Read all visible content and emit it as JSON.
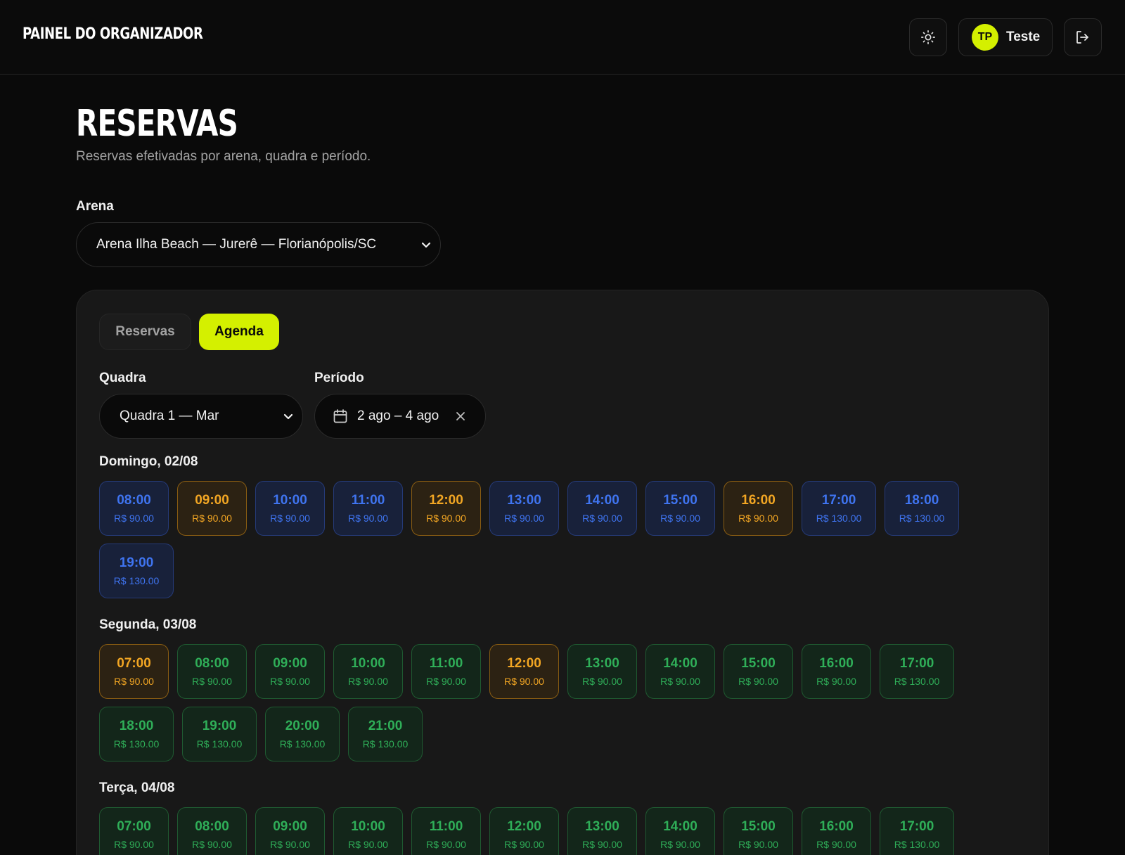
{
  "header": {
    "brand": "PAINEL DO ORGANIZADOR",
    "theme_icon": "sun-icon",
    "user": {
      "initials": "TP",
      "name": "Teste"
    },
    "logout_icon": "logout-icon"
  },
  "page": {
    "title": "RESERVAS",
    "subtitle": "Reservas efetivadas por arena, quadra e período."
  },
  "arena": {
    "label": "Arena",
    "selected": "Arena Ilha Beach — Jurerê — Florianópolis/SC"
  },
  "tabs": [
    {
      "label": "Reservas",
      "active": false
    },
    {
      "label": "Agenda",
      "active": true
    }
  ],
  "filters": {
    "court_label": "Quadra",
    "court_selected": "Quadra 1 — Mar",
    "period_label": "Período",
    "period_value": "2 ago – 4 ago"
  },
  "colors": {
    "accent": "#d4f000",
    "booked_blue": "#3f74f0",
    "pending_orange": "#f2a623",
    "available_green": "#2fae58"
  },
  "days": [
    {
      "title": "Domingo, 02/08",
      "slots": [
        {
          "time": "08:00",
          "price": "R$ 90.00",
          "status": "blue"
        },
        {
          "time": "09:00",
          "price": "R$ 90.00",
          "status": "orange"
        },
        {
          "time": "10:00",
          "price": "R$ 90.00",
          "status": "blue"
        },
        {
          "time": "11:00",
          "price": "R$ 90.00",
          "status": "blue"
        },
        {
          "time": "12:00",
          "price": "R$ 90.00",
          "status": "orange"
        },
        {
          "time": "13:00",
          "price": "R$ 90.00",
          "status": "blue"
        },
        {
          "time": "14:00",
          "price": "R$ 90.00",
          "status": "blue"
        },
        {
          "time": "15:00",
          "price": "R$ 90.00",
          "status": "blue"
        },
        {
          "time": "16:00",
          "price": "R$ 90.00",
          "status": "orange"
        },
        {
          "time": "17:00",
          "price": "R$ 130.00",
          "status": "blue"
        },
        {
          "time": "18:00",
          "price": "R$ 130.00",
          "status": "blue"
        },
        {
          "time": "19:00",
          "price": "R$ 130.00",
          "status": "blue"
        }
      ]
    },
    {
      "title": "Segunda, 03/08",
      "slots": [
        {
          "time": "07:00",
          "price": "R$ 90.00",
          "status": "orange"
        },
        {
          "time": "08:00",
          "price": "R$ 90.00",
          "status": "green"
        },
        {
          "time": "09:00",
          "price": "R$ 90.00",
          "status": "green"
        },
        {
          "time": "10:00",
          "price": "R$ 90.00",
          "status": "green"
        },
        {
          "time": "11:00",
          "price": "R$ 90.00",
          "status": "green"
        },
        {
          "time": "12:00",
          "price": "R$ 90.00",
          "status": "orange"
        },
        {
          "time": "13:00",
          "price": "R$ 90.00",
          "status": "green"
        },
        {
          "time": "14:00",
          "price": "R$ 90.00",
          "status": "green"
        },
        {
          "time": "15:00",
          "price": "R$ 90.00",
          "status": "green"
        },
        {
          "time": "16:00",
          "price": "R$ 90.00",
          "status": "green"
        },
        {
          "time": "17:00",
          "price": "R$ 130.00",
          "status": "green"
        },
        {
          "time": "18:00",
          "price": "R$ 130.00",
          "status": "green"
        },
        {
          "time": "19:00",
          "price": "R$ 130.00",
          "status": "green"
        },
        {
          "time": "20:00",
          "price": "R$ 130.00",
          "status": "green"
        },
        {
          "time": "21:00",
          "price": "R$ 130.00",
          "status": "green"
        }
      ]
    },
    {
      "title": "Terça, 04/08",
      "slots": [
        {
          "time": "07:00",
          "price": "R$ 90.00",
          "status": "green"
        },
        {
          "time": "08:00",
          "price": "R$ 90.00",
          "status": "green"
        },
        {
          "time": "09:00",
          "price": "R$ 90.00",
          "status": "green"
        },
        {
          "time": "10:00",
          "price": "R$ 90.00",
          "status": "green"
        },
        {
          "time": "11:00",
          "price": "R$ 90.00",
          "status": "green"
        },
        {
          "time": "12:00",
          "price": "R$ 90.00",
          "status": "green"
        },
        {
          "time": "13:00",
          "price": "R$ 90.00",
          "status": "green"
        },
        {
          "time": "14:00",
          "price": "R$ 90.00",
          "status": "green"
        },
        {
          "time": "15:00",
          "price": "R$ 90.00",
          "status": "green"
        },
        {
          "time": "16:00",
          "price": "R$ 90.00",
          "status": "green"
        },
        {
          "time": "17:00",
          "price": "R$ 130.00",
          "status": "green"
        }
      ]
    }
  ]
}
